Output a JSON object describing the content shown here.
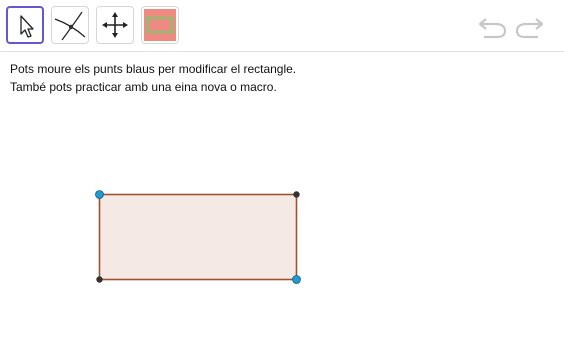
{
  "toolbar": {
    "tools": [
      {
        "name": "move",
        "icon": "cursor-arrow-icon",
        "selected": true
      },
      {
        "name": "intersect",
        "icon": "intersect-curves-icon",
        "selected": false
      },
      {
        "name": "move-graphics-view",
        "icon": "four-arrows-move-icon",
        "selected": false
      },
      {
        "name": "rectangle-macro",
        "icon": "rectangle-macro-icon",
        "selected": false
      }
    ],
    "undo_icon": "undo-icon",
    "redo_icon": "redo-icon"
  },
  "instructions": {
    "line1": "Pots moure els punts blaus per modificar el rectangle.",
    "line2": "També pots practicar amb una eina nova o macro."
  },
  "colors": {
    "accent": "#6557d2",
    "rect_fill": "#f5e9e5",
    "rect_stroke": "#a0522d",
    "free_point": "#1e9bd2",
    "dependent_point": "#333333",
    "tool_macro_bg": "#ee8a80",
    "tool_macro_rect": "#7bc96f"
  }
}
